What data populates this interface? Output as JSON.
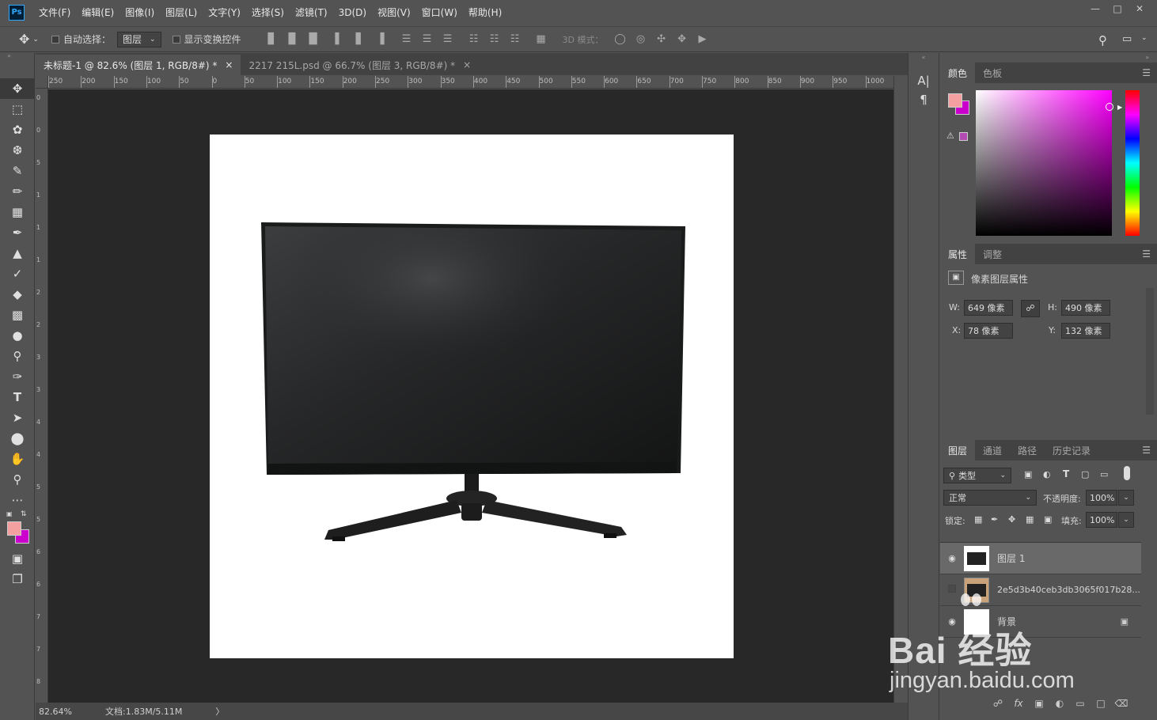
{
  "app": {
    "logo": "Ps"
  },
  "menu": [
    "文件(F)",
    "编辑(E)",
    "图像(I)",
    "图层(L)",
    "文字(Y)",
    "选择(S)",
    "滤镜(T)",
    "3D(D)",
    "视图(V)",
    "窗口(W)",
    "帮助(H)"
  ],
  "options": {
    "auto_select_label": "自动选择：",
    "auto_select_value": "图层",
    "show_transform_label": "显示变换控件",
    "mode_3d_label": "3D 模式："
  },
  "tabs": [
    {
      "label": "未标题-1 @ 82.6% (图层 1, RGB/8#) *",
      "close": "×"
    },
    {
      "label": "2217 215L.psd @ 66.7% (图层 3, RGB/8#) *",
      "close": "×"
    }
  ],
  "ruler_h": [
    "250",
    "200",
    "150",
    "100",
    "50",
    "0",
    "50",
    "100",
    "150",
    "200",
    "250",
    "300",
    "350",
    "400",
    "450",
    "500",
    "550",
    "600",
    "650",
    "700",
    "750",
    "800",
    "850",
    "900",
    "950",
    "1000"
  ],
  "ruler_v": [
    "0",
    "0",
    "5",
    "1",
    "1",
    "1",
    "2",
    "2",
    "3",
    "3",
    "4",
    "4",
    "5",
    "5",
    "6",
    "6",
    "7",
    "7",
    "8"
  ],
  "status": {
    "zoom": "82.64%",
    "doc": "文档:1.83M/5.11M",
    "arrow": "〉"
  },
  "color_panel": {
    "tabs": [
      "颜色",
      "色板"
    ],
    "fg": "#f4a0a0",
    "bg": "#cc00cc"
  },
  "properties_panel": {
    "tabs": [
      "属性",
      "调整"
    ],
    "title": "像素图层属性",
    "w_label": "W:",
    "w_value": "649 像素",
    "h_label": "H:",
    "h_value": "490 像素",
    "x_label": "X:",
    "x_value": "78 像素",
    "y_label": "Y:",
    "y_value": "132 像素"
  },
  "layers_panel": {
    "tabs": [
      "图层",
      "通道",
      "路径",
      "历史记录"
    ],
    "filter_value": "类型",
    "blend_mode": "正常",
    "opacity_label": "不透明度:",
    "opacity_value": "100%",
    "lock_label": "锁定:",
    "fill_label": "填充:",
    "fill_value": "100%",
    "layers": [
      {
        "name": "图层 1",
        "visible": true,
        "selected": true
      },
      {
        "name": "2e5d3b40ceb3db3065f017b28...",
        "visible": false,
        "selected": false
      },
      {
        "name": "背景",
        "visible": true,
        "selected": false
      }
    ]
  },
  "watermark": {
    "brand": "Bai 经验",
    "url": "jingyan.baidu.com"
  }
}
